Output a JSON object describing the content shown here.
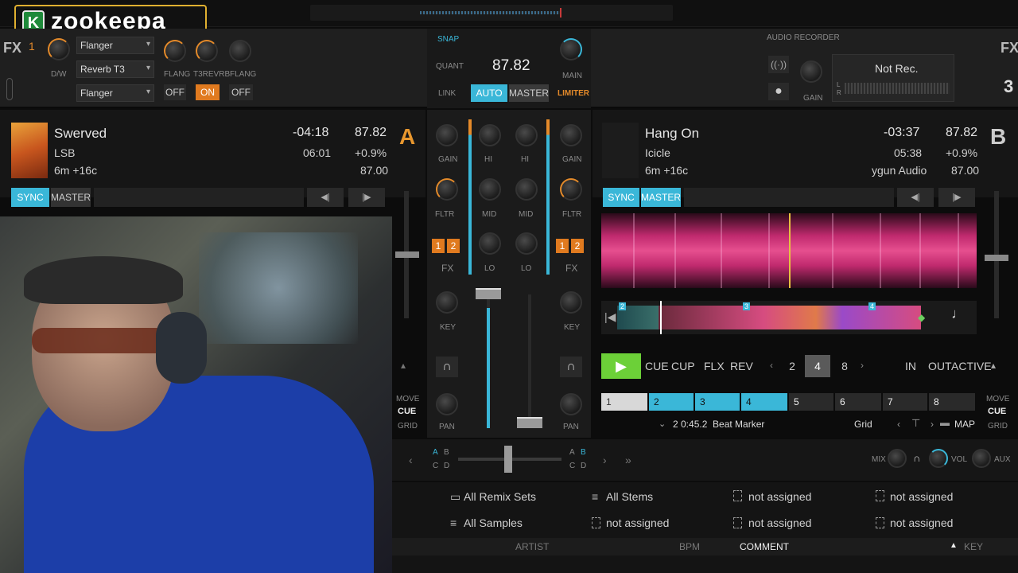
{
  "logo": {
    "text": "zookeepa",
    "badge": "K"
  },
  "fx": {
    "label_left": "FX",
    "label_right": "FX",
    "unit_left": "1",
    "unit_right": "3",
    "dw_label": "D/W",
    "selectors": [
      "Flanger",
      "Reverb T3",
      "Flanger"
    ],
    "knob_labels": [
      "FLANG",
      "T3REVRB",
      "FLANG"
    ],
    "buttons": [
      "OFF",
      "ON",
      "OFF"
    ]
  },
  "master": {
    "snap": "SNAP",
    "quant": "QUANT",
    "link": "LINK",
    "bpm": "87.82",
    "auto": "AUTO",
    "master": "MASTER",
    "main": "MAIN",
    "limiter": "LIMITER"
  },
  "recorder": {
    "title": "AUDIO RECORDER",
    "status": "Not Rec.",
    "gain": "GAIN",
    "l": "L",
    "r": "R"
  },
  "deckA": {
    "letter": "A",
    "title": "Swerved",
    "artist": "LSB",
    "key": "6m +16c",
    "remaining": "-04:18",
    "total": "06:01",
    "bpm": "87.82",
    "pitch": "+0.9%",
    "base_bpm": "87.00",
    "sync": "SYNC",
    "master": "MASTER"
  },
  "deckB": {
    "letter": "B",
    "title": "Hang On",
    "artist": "Icicle",
    "key": "6m +16c",
    "label": "уgun Audio",
    "remaining": "-03:37",
    "total": "05:38",
    "bpm": "87.82",
    "pitch": "+0.9%",
    "base_bpm": "87.00",
    "sync": "SYNC",
    "master": "MASTER",
    "play_icon": "play-icon",
    "cue": "CUE",
    "cup": "CUP",
    "flx": "FLX",
    "rev": "REV",
    "loop_sizes": [
      "2",
      "4",
      "8"
    ],
    "loop_active": "4",
    "in": "IN",
    "out": "OUT",
    "active": "ACTIVE",
    "hotcues": [
      "1",
      "2",
      "3",
      "4",
      "5",
      "6",
      "7",
      "8"
    ],
    "marker_text": "2 0:45.2  Beat Marker",
    "grid": "Grid",
    "map": "MAP",
    "strip_markers": [
      "2",
      "3",
      "4"
    ]
  },
  "mixer": {
    "gain": "GAIN",
    "hi": "HI",
    "mid": "MID",
    "lo": "LO",
    "fltr": "FLTR",
    "fx": "FX",
    "key": "KEY",
    "pan": "PAN",
    "fx1": "1",
    "fx2": "2"
  },
  "side": {
    "move": "MOVE",
    "cue": "CUE",
    "grid": "GRID"
  },
  "crossfader": {
    "a": "A",
    "b": "B",
    "c": "C",
    "d": "D",
    "mix": "MIX",
    "vol": "VOL",
    "aux": "AUX"
  },
  "browser": {
    "items": [
      "All Remix Sets",
      "All Stems",
      "not assigned",
      "not assigned",
      "All Samples",
      "not assigned",
      "not assigned",
      "not assigned"
    ],
    "columns": [
      "ARTIST",
      "BPM",
      "COMMENT",
      "KEY"
    ],
    "sort_icon": "sort-up-icon"
  }
}
